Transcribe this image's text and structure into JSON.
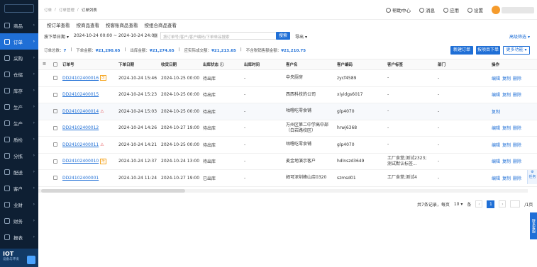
{
  "sidebar": {
    "items": [
      {
        "label": "商品",
        "active": false
      },
      {
        "label": "订单",
        "active": true
      },
      {
        "label": "采购",
        "active": false
      },
      {
        "label": "仓储",
        "active": false
      },
      {
        "label": "库存",
        "active": false
      },
      {
        "label": "生产",
        "active": false
      },
      {
        "label": "生产",
        "active": false
      },
      {
        "label": "质检",
        "active": false
      },
      {
        "label": "分拣",
        "active": false
      },
      {
        "label": "配送",
        "active": false
      },
      {
        "label": "客户",
        "active": false
      },
      {
        "label": "业财",
        "active": false
      },
      {
        "label": "财务",
        "active": false
      },
      {
        "label": "报表",
        "active": false
      },
      {
        "label": "学生餐",
        "active": false
      }
    ],
    "promo_title": "IOT",
    "promo_sub": "设备与环境"
  },
  "breadcrumb": [
    "订单",
    "订单管理",
    "订单列表"
  ],
  "topbar": {
    "help": "帮助中心",
    "message": "消息",
    "apps": "应用",
    "settings": "设置"
  },
  "tabs": [
    "按订单查看",
    "按商品查看",
    "按客账商品查看",
    "按组合商品查看"
  ],
  "filter": {
    "date_type": "按下单日期",
    "date_range": "2024-10-24 00:00 ~ 2024-10-24 24:00",
    "search_placeholder": "按订单号/客户/客户编码/下单单品搜索",
    "search_btn": "搜索",
    "export_btn": "导出",
    "advanced": "高级筛选"
  },
  "summary": {
    "total_label": "订单总数：",
    "total": "7",
    "order_amount_label": "下单金额：",
    "order_amount": "¥21,290.65",
    "out_amount_label": "出库金额：",
    "out_amount": "¥21,274.65",
    "est_label": "应实际成交额：",
    "est": "¥21,213.65",
    "tax_label": "不含税销售额金额：",
    "tax": "¥21,210.75"
  },
  "actions": {
    "new_order": "新建订单",
    "copy_order": "按项目下单",
    "more": "更多功能"
  },
  "columns": [
    "订单号",
    "下单日期",
    "收货日期",
    "出库状态",
    "出库时间",
    "客户名",
    "客户编码",
    "客户标签",
    "部门",
    "操作"
  ],
  "rows": [
    {
      "no": "DD24102400016",
      "badge": "改",
      "order_date": "2024-10-24 15:46",
      "recv_date": "2024-10-25 00:00",
      "status": "待出库",
      "out_time": "-",
      "customer": "中央厨房",
      "code": "zycf4589",
      "tag": "-",
      "dept": "-",
      "acts": [
        "编辑",
        "复制",
        "删除"
      ]
    },
    {
      "no": "DD24102400015",
      "badge": "",
      "order_date": "2024-10-24 15:23",
      "recv_date": "2024-10-25 00:00",
      "status": "待出库",
      "out_time": "-",
      "customer": "西西科技的公司",
      "code": "xiyidgs6017",
      "tag": "-",
      "dept": "-",
      "acts": [
        "编辑",
        "复制",
        "删除"
      ]
    },
    {
      "no": "DD24102400014",
      "badge": "⚠",
      "order_date": "2024-10-24 15:03",
      "recv_date": "2024-10-25 00:00",
      "status": "待出库",
      "out_time": "-",
      "customer": "咕噜吃零食铺",
      "code": "glp4070",
      "tag": "-",
      "dept": "-",
      "acts": [
        "复制"
      ]
    },
    {
      "no": "DD24102400012",
      "badge": "",
      "order_date": "2024-10-24 14:26",
      "recv_date": "2024-10-27 19:00",
      "status": "待出库",
      "out_time": "-",
      "customer": "万州区第二中学高中部（白岩路校区）",
      "code": "hrwj6368",
      "tag": "-",
      "dept": "-",
      "acts": [
        "编辑",
        "复制",
        "删除"
      ]
    },
    {
      "no": "DD24102400011",
      "badge": "⚠",
      "order_date": "2024-10-24 14:21",
      "recv_date": "2024-10-25 00:00",
      "status": "待出库",
      "out_time": "-",
      "customer": "咕噜吃零食铺",
      "code": "glp4070",
      "tag": "-",
      "dept": "-",
      "acts": [
        "编辑",
        "复制",
        "删除"
      ]
    },
    {
      "no": "DD24102400010",
      "badge": "改",
      "order_date": "2024-10-24 12:37",
      "recv_date": "2024-10-24 13:00",
      "status": "待出库",
      "out_time": "-",
      "customer": "麦金地演示客户",
      "code": "hdlnszd3649",
      "tag": "工厂食堂;测试2323;测试默认标签...",
      "dept": "-",
      "acts": [
        "编辑",
        "复制",
        "删除"
      ]
    },
    {
      "no": "DD24102400001",
      "badge": "",
      "order_date": "2024-10-24 11:24",
      "recv_date": "2024-10-27 19:00",
      "status": "已出库",
      "out_time": "-",
      "customer": "姆可深圳峰山店0320",
      "code": "szmsd01",
      "tag": "工厂食堂;测试4",
      "dept": "-",
      "acts": [
        "编辑",
        "复制",
        "删除"
      ]
    }
  ],
  "pager": {
    "summary": "共7条记录，每页",
    "page_size": "10",
    "unit": "条",
    "current": "1",
    "total_pages": "/1页",
    "prev": "‹",
    "next": "›"
  },
  "right_float": "任务",
  "right_tab": "联系客服"
}
